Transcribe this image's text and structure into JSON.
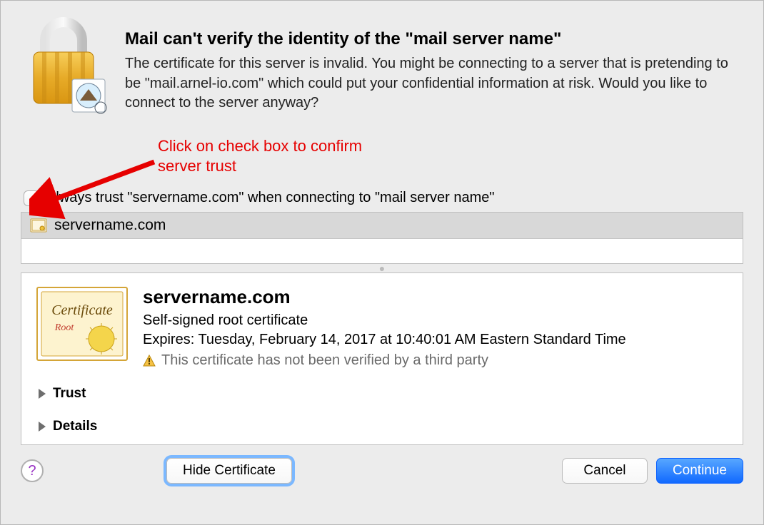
{
  "header": {
    "title": "Mail can't verify the identity of the \"mail server name\"",
    "body": "The certificate for this server is invalid. You might be connecting to a server that is pretending to be \"mail.arnel-io.com\" which could put your confidential information at risk. Would you like to connect to the server anyway?"
  },
  "annotation": {
    "line1": "Click on check box to confirm",
    "line2": "server trust"
  },
  "always_trust": {
    "checked": false,
    "label": "Always trust \"servername.com\" when connecting to \"mail server name\""
  },
  "cert_list": {
    "items": [
      {
        "name": "servername.com"
      }
    ]
  },
  "cert_detail": {
    "name": "servername.com",
    "kind": "Self-signed root certificate",
    "expires": "Expires: Tuesday, February 14, 2017 at 10:40:01 AM Eastern Standard Time",
    "warning": "This certificate has not been verified by a third party",
    "sections": {
      "trust": "Trust",
      "details": "Details"
    }
  },
  "buttons": {
    "hide_certificate": "Hide Certificate",
    "cancel": "Cancel",
    "continue": "Continue"
  },
  "help_glyph": "?"
}
